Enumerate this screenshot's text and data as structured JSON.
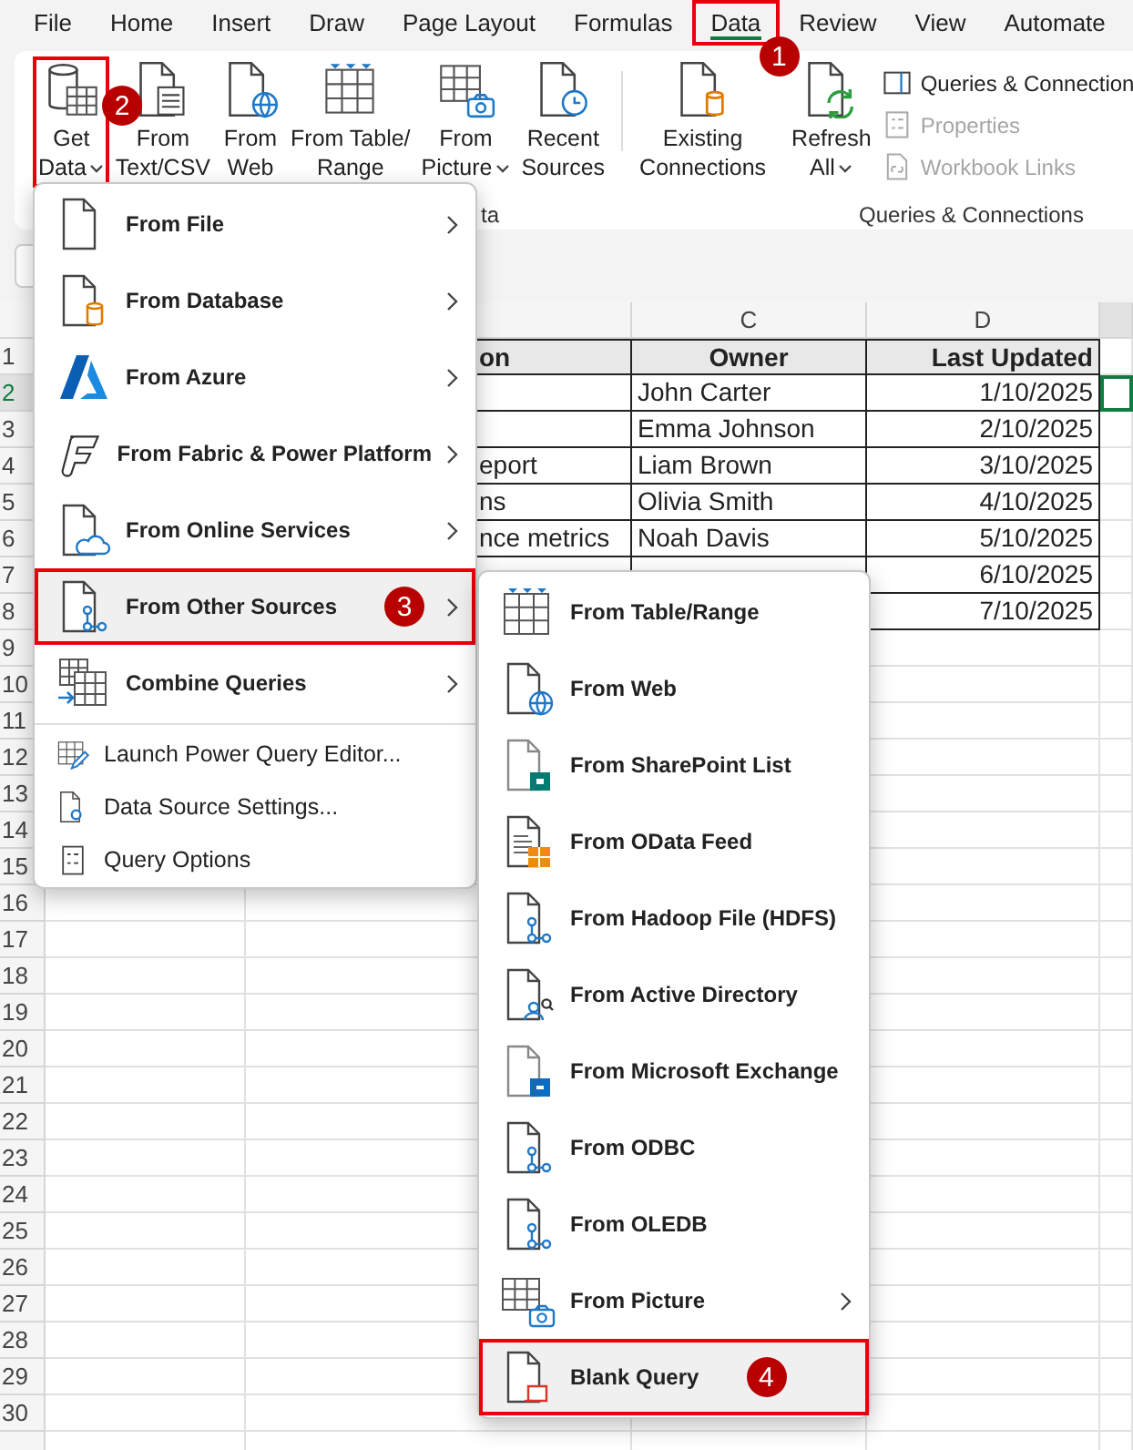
{
  "tabs": [
    {
      "label": "File",
      "selected": false
    },
    {
      "label": "Home",
      "selected": false
    },
    {
      "label": "Insert",
      "selected": false
    },
    {
      "label": "Draw",
      "selected": false
    },
    {
      "label": "Page Layout",
      "selected": false
    },
    {
      "label": "Formulas",
      "selected": false
    },
    {
      "label": "Data",
      "selected": true,
      "callout": "1"
    },
    {
      "label": "Review",
      "selected": false
    },
    {
      "label": "View",
      "selected": false
    },
    {
      "label": "Automate",
      "selected": false
    }
  ],
  "ribbon": {
    "buttons": [
      {
        "label": "Get\nData",
        "dropdown": true,
        "callout": "2"
      },
      {
        "label": "From\nText/CSV",
        "dropdown": false
      },
      {
        "label": "From\nWeb",
        "dropdown": false
      },
      {
        "label": "From Table/\nRange",
        "dropdown": false
      },
      {
        "label": "From\nPicture",
        "dropdown": true
      },
      {
        "label": "Recent\nSources",
        "dropdown": false
      },
      {
        "label": "Existing\nConnections",
        "dropdown": false
      },
      {
        "label": "Refresh\nAll",
        "dropdown": true
      }
    ],
    "side_items": [
      {
        "label": "Queries & Connection",
        "disabled": false
      },
      {
        "label": "Properties",
        "disabled": true
      },
      {
        "label": "Workbook Links",
        "disabled": true
      }
    ],
    "group_labels": [
      "ta",
      "Queries & Connections"
    ]
  },
  "column_headers": [
    "C",
    "D"
  ],
  "table": {
    "header": [
      "on",
      "Owner",
      "Last Updated"
    ],
    "rows": [
      [
        null,
        "John Carter",
        "1/10/2025"
      ],
      [
        null,
        "Emma Johnson",
        "2/10/2025"
      ],
      [
        "eport",
        "Liam Brown",
        "3/10/2025"
      ],
      [
        "ns",
        "Olivia Smith",
        "4/10/2025"
      ],
      [
        "nce metrics",
        "Noah Davis",
        "5/10/2025"
      ],
      [
        null,
        null,
        "6/10/2025"
      ],
      [
        null,
        null,
        "7/10/2025"
      ]
    ]
  },
  "rows": [
    {
      "number": "1",
      "selected": false
    },
    {
      "number": "2",
      "selected": true
    },
    {
      "number": "3",
      "selected": false
    },
    {
      "number": "4",
      "selected": false
    },
    {
      "number": "5",
      "selected": false
    },
    {
      "number": "6",
      "selected": false
    },
    {
      "number": "7",
      "selected": false
    },
    {
      "number": "8",
      "selected": false
    },
    {
      "number": "9",
      "selected": false
    },
    {
      "number": "10",
      "selected": false
    },
    {
      "number": "11",
      "selected": false
    },
    {
      "number": "12",
      "selected": false
    },
    {
      "number": "13",
      "selected": false
    },
    {
      "number": "14",
      "selected": false
    },
    {
      "number": "15",
      "selected": false
    },
    {
      "number": "16",
      "selected": false
    },
    {
      "number": "17",
      "selected": false
    },
    {
      "number": "18",
      "selected": false
    },
    {
      "number": "19",
      "selected": false
    },
    {
      "number": "20",
      "selected": false
    },
    {
      "number": "21",
      "selected": false
    },
    {
      "number": "22",
      "selected": false
    },
    {
      "number": "23",
      "selected": false
    },
    {
      "number": "24",
      "selected": false
    },
    {
      "number": "25",
      "selected": false
    },
    {
      "number": "26",
      "selected": false
    },
    {
      "number": "27",
      "selected": false
    },
    {
      "number": "28",
      "selected": false
    },
    {
      "number": "29",
      "selected": false
    },
    {
      "number": "30",
      "selected": false
    }
  ],
  "get_data_menu": {
    "items": [
      {
        "label": "From File",
        "kind": "large",
        "submenu": true,
        "selected": false
      },
      {
        "label": "From Database",
        "kind": "large",
        "submenu": true,
        "selected": false
      },
      {
        "label": "From Azure",
        "kind": "large",
        "submenu": true,
        "selected": false
      },
      {
        "label": "From Fabric & Power Platform",
        "kind": "large",
        "submenu": true,
        "selected": false
      },
      {
        "label": "From Online Services",
        "kind": "large",
        "submenu": true,
        "selected": false
      },
      {
        "label": "From Other Sources",
        "kind": "large",
        "submenu": true,
        "selected": true,
        "callout": "3"
      },
      {
        "label": "Combine Queries",
        "kind": "large",
        "submenu": true,
        "selected": false
      },
      {
        "label": "Launch Power Query Editor...",
        "kind": "small",
        "submenu": false,
        "selected": false
      },
      {
        "label": "Data Source Settings...",
        "kind": "small",
        "submenu": false,
        "selected": false
      },
      {
        "label": "Query Options",
        "kind": "small",
        "submenu": false,
        "selected": false
      }
    ]
  },
  "other_sources_menu": {
    "items": [
      {
        "label": "From Table/Range",
        "submenu": false,
        "selected": false
      },
      {
        "label": "From Web",
        "submenu": false,
        "selected": false
      },
      {
        "label": "From SharePoint List",
        "submenu": false,
        "selected": false
      },
      {
        "label": "From OData Feed",
        "submenu": false,
        "selected": false
      },
      {
        "label": "From Hadoop File (HDFS)",
        "submenu": false,
        "selected": false
      },
      {
        "label": "From Active Directory",
        "submenu": false,
        "selected": false
      },
      {
        "label": "From Microsoft Exchange",
        "submenu": false,
        "selected": false
      },
      {
        "label": "From ODBC",
        "submenu": false,
        "selected": false
      },
      {
        "label": "From OLEDB",
        "submenu": false,
        "selected": false
      },
      {
        "label": "From Picture",
        "submenu": true,
        "selected": false
      },
      {
        "label": "Blank Query",
        "submenu": false,
        "selected": true,
        "callout": "4"
      }
    ]
  }
}
